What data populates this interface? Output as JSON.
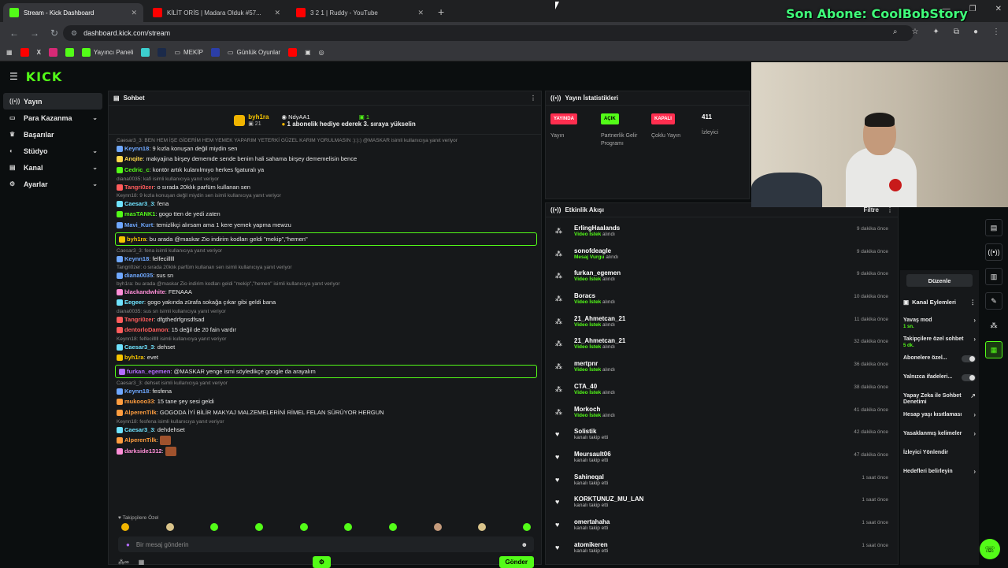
{
  "tabs": [
    {
      "title": "Stream - Kick Dashboard",
      "color": "#53fc18",
      "active": true
    },
    {
      "title": "KİLİT ORİS | Madara Olduk #57...",
      "color": "#ff0000",
      "active": false
    },
    {
      "title": "3 2 1 | Ruddy - YouTube",
      "color": "#ff0000",
      "active": false
    }
  ],
  "overlay_text": "Son Abone: CoolBobStory",
  "url": "dashboard.kick.com/stream",
  "bookmarks": [
    "Yayıncı Paneli",
    "MEKİP",
    "Günlük Oyunlar"
  ],
  "logo": "KICK",
  "sidebar": [
    {
      "label": "Yayın",
      "icon": "broadcast-icon",
      "active": true,
      "chevron": false
    },
    {
      "label": "Para Kazanma",
      "icon": "money-icon",
      "active": false,
      "chevron": true
    },
    {
      "label": "Başarılar",
      "icon": "trophy-icon",
      "active": false,
      "chevron": false
    },
    {
      "label": "Stüdyo",
      "icon": "studio-icon",
      "active": false,
      "chevron": true
    },
    {
      "label": "Kanal",
      "icon": "channel-icon",
      "active": false,
      "chevron": true
    },
    {
      "label": "Ayarlar",
      "icon": "settings-icon",
      "active": false,
      "chevron": true
    }
  ],
  "chat": {
    "title": "Sohbet",
    "pinned_user": "byh1ra",
    "pinned_sub_count": "21",
    "pinned_gifter": "NdyAA1",
    "pinned_gifter_count": "1",
    "pinned_text": "1 abonelik hediye ederek 3. sıraya yükselin",
    "follow_only": "Takipçilere Özel",
    "input_placeholder": "Bir mesaj gönderin",
    "send_label": "Gönder",
    "messages": [
      {
        "reply": "Caesar3_3: BEN HEM İŞE GİDERİM HEM YEMEK YAPARIM YETERKİ GÜZEL KARIM YORULMASIN :):):) @MASKAR isimli kullanıcıya yanıt veriyor",
        "user": "Keynn18",
        "color": "#6fa8ff",
        "text": "9 kızla konuşan değil miydin sen",
        "hl": false
      },
      {
        "reply": "",
        "user": "Anqite",
        "color": "#ffd84d",
        "text": "makyajina birşey dememde sende benim hali sahama birşey dememelisin bence",
        "hl": false
      },
      {
        "reply": "",
        "user": "Cedric_c",
        "color": "#53fc18",
        "text": "kontör artık kulanılmıyo herkes fgaturalı ya",
        "hl": false
      },
      {
        "reply": "diana0035: kafi isimli kullanıcıya yanıt veriyor",
        "user": "Tangri0zer",
        "color": "#ff5c5c",
        "text": "o sırada 20klık parfüm kullanan sen",
        "hl": false
      },
      {
        "reply": "Keynn18: 9 kızla konuşan değil miydin sen isimli kullanıcıya yanıt veriyor",
        "user": "Caesar3_3",
        "color": "#6fe3ff",
        "text": "fena",
        "hl": false
      },
      {
        "reply": "",
        "user": "masTANK1",
        "color": "#53fc18",
        "text": "gogo tten de yedi zaten",
        "hl": false
      },
      {
        "reply": "",
        "user": "Mavi_Kurt",
        "color": "#6fa8ff",
        "text": "temizlikçi alırsam ama 1 kere yemek yapma mewzu",
        "hl": false
      },
      {
        "reply": "",
        "user": "byh1ra",
        "color": "#f5c400",
        "text": "bu arada @maskar Zio indirim kodları geldi \"mekip\",\"hemen\"",
        "hl": true
      },
      {
        "reply": "Caesar3_3: fena isimli kullanıcıya yanıt veriyor",
        "user": "Keynn18",
        "color": "#6fa8ff",
        "text": "felfecilllll",
        "hl": false
      },
      {
        "reply": "Tangri0zer: o sırada 20klık parfüm kullanan sen isimli kullanıcıya yanıt veriyor",
        "user": "diana0035",
        "color": "#6fa8ff",
        "text": "sus sn",
        "hl": false
      },
      {
        "reply": "byh1ra: bu arada @maskar Zio indirim kodları geldi \"mekip\",\"hemen\" isimli kullanıcıya yanıt veriyor",
        "user": "blackandwhite",
        "color": "#ff8fd8",
        "text": "FENAAA",
        "hl": false
      },
      {
        "reply": "",
        "user": "Eegeer",
        "color": "#6fe3ff",
        "text": "gogo yakında zürafa sokağa çıkar gibi geldi bana",
        "hl": false
      },
      {
        "reply": "diana0035: sus sn isimli kullanıcıya yanıt veriyor",
        "user": "Tangri0zer",
        "color": "#ff5c5c",
        "text": "dfgthedrfgnsdfsad",
        "hl": false
      },
      {
        "reply": "",
        "user": "dentorloDamon",
        "color": "#ff5c5c",
        "text": "15 değil de 20 fain vardır",
        "hl": false
      },
      {
        "reply": "Keynn18: felfecilllll isimli kullanıcıya yanıt veriyor",
        "user": "Caesar3_3",
        "color": "#6fe3ff",
        "text": "dehset",
        "hl": false
      },
      {
        "reply": "",
        "user": "byh1ra",
        "color": "#f5c400",
        "text": "evet",
        "hl": false
      },
      {
        "reply": "",
        "user": "furkan_egemen",
        "color": "#b46cff",
        "text": "@MASKAR yenge ismi söyledikçe google da arayalım",
        "hl": true
      },
      {
        "reply": "Caesar3_3: dehset isimli kullanıcıya yanıt veriyor",
        "user": "Keynn18",
        "color": "#6fa8ff",
        "text": "fesfena",
        "hl": false
      },
      {
        "reply": "",
        "user": "mukooo33",
        "color": "#ff9d3f",
        "text": "15 tane şey sesi geldi",
        "hl": false
      },
      {
        "reply": "",
        "user": "AlperenTilk",
        "color": "#ff9d3f",
        "text": "GOGODA İYİ BİLİR MAKYAJ MALZEMELERİNİ RİMEL FELAN SÜRÜYOR HERGUN",
        "hl": false
      },
      {
        "reply": "Keynn18: fesfena isimli kullanıcıya yanıt veriyor",
        "user": "Caesar3_3",
        "color": "#6fe3ff",
        "text": "dehdehset",
        "hl": false
      },
      {
        "reply": "",
        "user": "AlperenTilk",
        "color": "#ff9d3f",
        "text": "",
        "hl": false
      },
      {
        "reply": "",
        "user": "darkside1312",
        "color": "#ff8fd8",
        "text": "",
        "hl": false
      }
    ]
  },
  "stats": {
    "title": "Yayın İstatistikleri",
    "items": [
      {
        "badge": "YAYINDA",
        "badge_bg": "#ff2e4f",
        "badge_fg": "#fff",
        "label": "Yayın"
      },
      {
        "badge": "AÇIK",
        "badge_bg": "#53fc18",
        "badge_fg": "#000",
        "label": "Partnerlik Gelir Programı"
      },
      {
        "badge": "KAPALI",
        "badge_bg": "#ff2e4f",
        "badge_fg": "#fff",
        "label": "Çoklu Yayın"
      },
      {
        "num": "411",
        "label": "İzleyici"
      }
    ]
  },
  "activity": {
    "title": "Etkinlik Akışı",
    "filter": "Filtre",
    "items": [
      {
        "name": "ErlingHaalands",
        "hi": "Video İstek",
        "rest": " alındı",
        "time": "9 dakika önce",
        "kind": "redeem"
      },
      {
        "name": "sonofdeagle",
        "hi": "Mesaj Vurgu",
        "rest": " alındı",
        "time": "9 dakika önce",
        "kind": "redeem"
      },
      {
        "name": "furkan_egemen",
        "hi": "Video İstek",
        "rest": " alındı",
        "time": "9 dakika önce",
        "kind": "redeem"
      },
      {
        "name": "Boracs",
        "hi": "Video İstek",
        "rest": " alındı",
        "time": "10 dakika önce",
        "kind": "redeem"
      },
      {
        "name": "21_Ahmetcan_21",
        "hi": "Video İstek",
        "rest": " alındı",
        "time": "11 dakika önce",
        "kind": "redeem"
      },
      {
        "name": "21_Ahmetcan_21",
        "hi": "Video İstek",
        "rest": " alındı",
        "time": "32 dakika önce",
        "kind": "redeem"
      },
      {
        "name": "mertpnr",
        "hi": "Video İstek",
        "rest": " alındı",
        "time": "36 dakika önce",
        "kind": "redeem"
      },
      {
        "name": "CTA_40",
        "hi": "Video İstek",
        "rest": " alındı",
        "time": "38 dakika önce",
        "kind": "redeem"
      },
      {
        "name": "Morkoch",
        "hi": "Video İstek",
        "rest": " alındı",
        "time": "41 dakika önce",
        "kind": "redeem"
      },
      {
        "name": "Solistik",
        "hi": "",
        "rest": "kanalı takip etti",
        "time": "42 dakika önce",
        "kind": "follow"
      },
      {
        "name": "Meursault06",
        "hi": "",
        "rest": "kanalı takip etti",
        "time": "47 dakika önce",
        "kind": "follow"
      },
      {
        "name": "Sahineqal",
        "hi": "",
        "rest": "kanalı takip etti",
        "time": "1 saat önce",
        "kind": "follow"
      },
      {
        "name": "KORKTUNUZ_MU_LAN",
        "hi": "",
        "rest": "kanalı takip etti",
        "time": "1 saat önce",
        "kind": "follow"
      },
      {
        "name": "omertahaha",
        "hi": "",
        "rest": "kanalı takip etti",
        "time": "1 saat önce",
        "kind": "follow"
      },
      {
        "name": "atomikeren",
        "hi": "",
        "rest": "kanalı takip etti",
        "time": "1 saat önce",
        "kind": "follow"
      }
    ]
  },
  "kanal": {
    "edit_label": "Düzenle",
    "title": "Kanal Eylemleri",
    "items": [
      {
        "label": "Yavaş mod",
        "sub": "1 sn.",
        "ctl": "chev"
      },
      {
        "label": "Takipçilere özel sohbet",
        "sub": "5 dk.",
        "ctl": "chev"
      },
      {
        "label": "Abonelere özel...",
        "sub": "",
        "ctl": "toggle"
      },
      {
        "label": "Yalnızca ifadeleri...",
        "sub": "",
        "ctl": "toggle"
      },
      {
        "label": "Yapay Zeka ile Sohbet Denetimi",
        "sub": "",
        "ctl": "ext"
      },
      {
        "label": "Hesap yaşı kısıtlaması",
        "sub": "",
        "ctl": "chev"
      },
      {
        "label": "Yasaklanmış kelimeler",
        "sub": "",
        "ctl": "chev"
      },
      {
        "label": "İzleyici Yönlendir",
        "sub": "",
        "ctl": "none"
      },
      {
        "label": "Hedefleri belirleyin",
        "sub": "",
        "ctl": "chev"
      }
    ]
  }
}
